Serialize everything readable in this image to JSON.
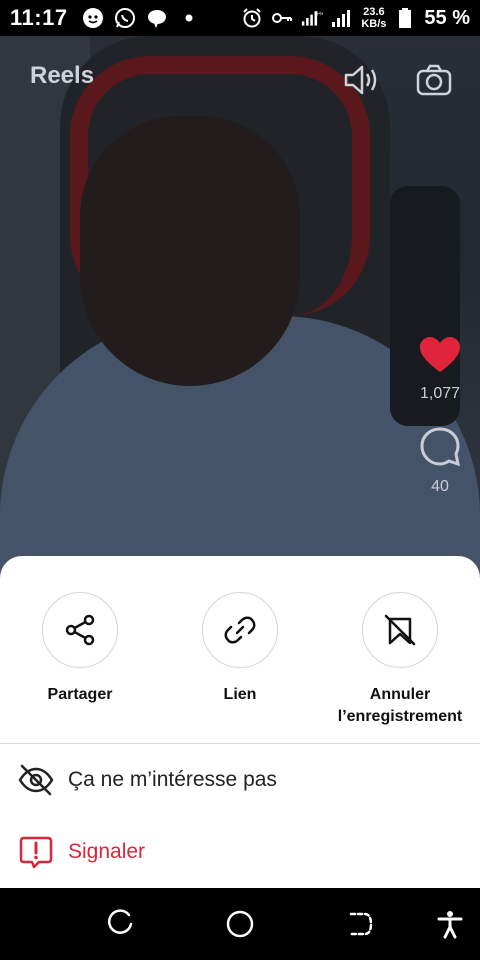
{
  "status_bar": {
    "time": "11:17",
    "net_speed_value": "23.6",
    "net_speed_unit": "KB/s",
    "battery": "55 %"
  },
  "header": {
    "title": "Reels",
    "icons": [
      "volume-icon",
      "camera-icon"
    ]
  },
  "side_actions": {
    "likes": "1,077",
    "comments": "40"
  },
  "sheet": {
    "share_options": [
      {
        "icon": "share-icon",
        "label": "Partager"
      },
      {
        "icon": "link-icon",
        "label": "Lien"
      },
      {
        "icon": "unsave-icon",
        "label": "Annuler\nl’enregistrement"
      }
    ],
    "menu": [
      {
        "icon": "eye-off-icon",
        "label": "Ça ne m’intéresse pas"
      },
      {
        "icon": "report-icon",
        "label": "Signaler"
      }
    ]
  },
  "colors": {
    "danger": "#d8263a",
    "like": "#e0243c"
  }
}
